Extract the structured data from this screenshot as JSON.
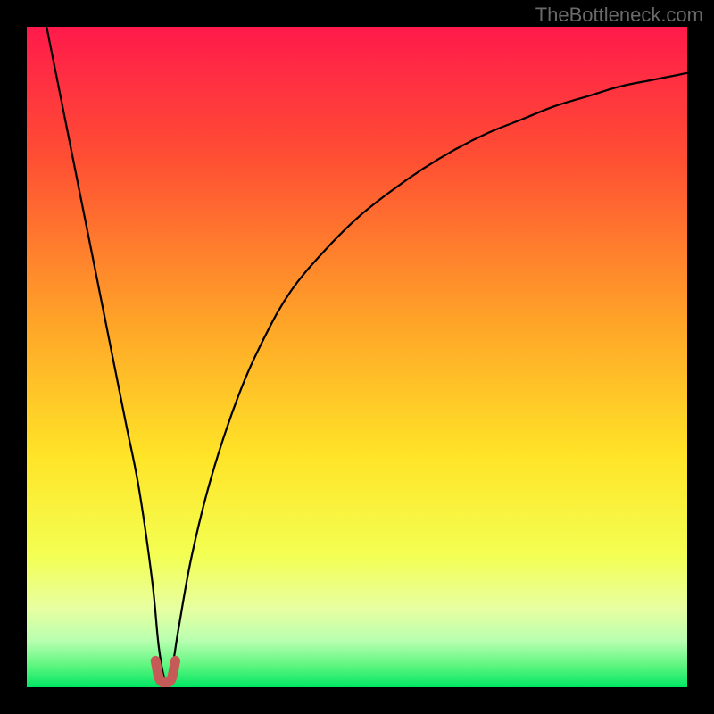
{
  "watermark": {
    "text": "TheBottleneck.com"
  },
  "chart_data": {
    "type": "line",
    "title": "",
    "xlabel": "",
    "ylabel": "",
    "xlim": [
      0,
      100
    ],
    "ylim": [
      0,
      100
    ],
    "x_optimum": 21,
    "series": [
      {
        "name": "bottleneck-curve",
        "x": [
          3,
          5,
          7,
          9,
          11,
          13,
          15,
          17,
          19,
          20,
          21,
          22,
          23,
          25,
          28,
          32,
          36,
          40,
          45,
          50,
          55,
          60,
          65,
          70,
          75,
          80,
          85,
          90,
          95,
          100
        ],
        "values": [
          100,
          90,
          80,
          70,
          60,
          50,
          40,
          30,
          16,
          6,
          1,
          3,
          9,
          20,
          32,
          44,
          53,
          60,
          66,
          71,
          75,
          78.5,
          81.5,
          84,
          86,
          88,
          89.5,
          91,
          92,
          93
        ]
      },
      {
        "name": "optimum-marker",
        "x": [
          19.5,
          20,
          20.5,
          21,
          21.5,
          22,
          22.5
        ],
        "values": [
          4,
          1.5,
          0.8,
          0.5,
          0.8,
          1.5,
          4
        ]
      }
    ],
    "gradient_stops": [
      {
        "offset": 0,
        "color": "#ff1a4b"
      },
      {
        "offset": 20,
        "color": "#ff4f33"
      },
      {
        "offset": 45,
        "color": "#ffa528"
      },
      {
        "offset": 65,
        "color": "#ffe427"
      },
      {
        "offset": 80,
        "color": "#f3ff52"
      },
      {
        "offset": 88,
        "color": "#e8ffa0"
      },
      {
        "offset": 93,
        "color": "#b8ffb0"
      },
      {
        "offset": 97,
        "color": "#57f57c"
      },
      {
        "offset": 100,
        "color": "#00e565"
      }
    ],
    "marker_color": "#c65a57",
    "curve_color": "#000000"
  }
}
